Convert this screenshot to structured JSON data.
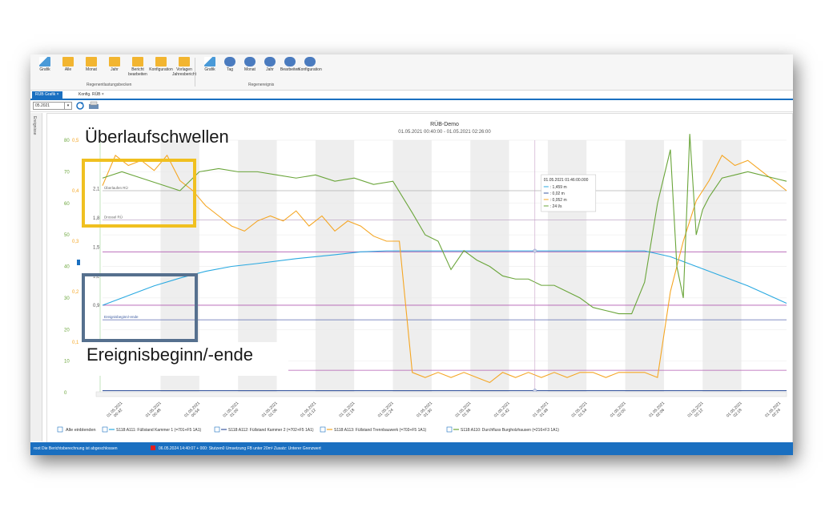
{
  "ribbon": {
    "buttons_left": [
      {
        "label": "Grafik",
        "icon": "chart-icon"
      },
      {
        "label": "Alle",
        "icon": "calendar-icon"
      },
      {
        "label": "Monat",
        "icon": "calendar-icon"
      },
      {
        "label": "Jahr",
        "icon": "calendar-icon"
      },
      {
        "label": "Bericht bearbeiten",
        "icon": "edit-icon"
      },
      {
        "label": "Konfiguration",
        "icon": "config-icon"
      },
      {
        "label": "Vorlagen Jahresbericht",
        "icon": "document-icon"
      }
    ],
    "group_left": "Regenentlastungsbecken",
    "buttons_right": [
      {
        "label": "Grafik",
        "icon": "chart-icon"
      },
      {
        "label": "Tag",
        "icon": "cloud-icon"
      },
      {
        "label": "Monat",
        "icon": "cloud-icon"
      },
      {
        "label": "Jahr",
        "icon": "cloud-icon"
      },
      {
        "label": "Bearbeiten",
        "icon": "cloud-edit-icon"
      },
      {
        "label": "Konfiguration",
        "icon": "cloud-icon"
      }
    ],
    "group_right": "Regenereignis"
  },
  "tabs": [
    {
      "label": "RÜB Grafik",
      "active": true
    },
    {
      "label": "Konfig. RÜB",
      "active": false
    }
  ],
  "toolbar": {
    "date_value": "05.2021"
  },
  "sidebar": {
    "label": "Ereignisse"
  },
  "overlays": {
    "thresholds": "Überlaufschwellen",
    "event": "Ereignisbeginn/-ende"
  },
  "colors": {
    "blue_series": "#29a9e1",
    "navy_series": "#3b5aa0",
    "orange_series": "#f5a623",
    "green_series": "#6aa53a",
    "threshold_lines": "#b05ab0",
    "accent": "#1a6fc0"
  },
  "chart_data": {
    "type": "line",
    "title": "RÜB-Demo",
    "subtitle": "01.05.2021 00:40:00 - 01.05.2021 02:26:00",
    "x_ticks": [
      "01.05.2021 00:42",
      "01.05.2021 00:48",
      "01.05.2021 00:54",
      "01.05.2021 01:00",
      "01.05.2021 01:06",
      "01.05.2021 01:12",
      "01.05.2021 01:18",
      "01.05.2021 01:24",
      "01.05.2021 01:30",
      "01.05.2021 01:36",
      "01.05.2021 01:42",
      "01.05.2021 01:48",
      "01.05.2021 01:54",
      "01.05.2021 02:00",
      "01.05.2021 02:06",
      "01.05.2021 02:12",
      "01.05.2021 02:18",
      "01.05.2021 02:24"
    ],
    "x_range": [
      0,
      106
    ],
    "y_axes": {
      "green": {
        "ticks": [
          "0",
          "10",
          "20",
          "30",
          "40",
          "50",
          "60",
          "70",
          "80"
        ],
        "range": [
          0,
          80
        ]
      },
      "orange": {
        "ticks": [
          "0,1",
          "0,2",
          "0,3",
          "0,4",
          "0,5"
        ],
        "range": [
          0,
          0.5
        ]
      },
      "blue": {
        "ticks": [
          "0,9",
          "1,2",
          "1,5",
          "1,8",
          "2,1"
        ],
        "range": [
          0,
          2.6
        ]
      }
    },
    "threshold_labels": [
      "Überlaufen RÜ",
      "Drossel RÜ",
      "Ereignisbeginn/-ende"
    ],
    "series": [
      {
        "name": "S118:A111: Füllstand Kammer 1 (=701+F5 1A1)",
        "color": "#29a9e1",
        "axis": "blue",
        "x": [
          0,
          4,
          8,
          12,
          16,
          20,
          24,
          30,
          36,
          40,
          44,
          48,
          52,
          56,
          60,
          64,
          68,
          72,
          76,
          80,
          84,
          88,
          92,
          96,
          100,
          104,
          106
        ],
        "values": [
          0.9,
          1.0,
          1.1,
          1.18,
          1.25,
          1.3,
          1.33,
          1.38,
          1.42,
          1.45,
          1.46,
          1.46,
          1.46,
          1.46,
          1.46,
          1.46,
          1.46,
          1.46,
          1.46,
          1.46,
          1.46,
          1.4,
          1.3,
          1.2,
          1.1,
          0.98,
          0.92
        ]
      },
      {
        "name": "S118:A112: Füllstand Kammer 2 (=702+F5 1A1)",
        "color": "#3b5aa0",
        "axis": "blue",
        "x": [
          0,
          106
        ],
        "values": [
          0.02,
          0.02
        ]
      },
      {
        "name": "S118:A113: Füllstand Trennbauwerk (=703+F5 1A1)",
        "color": "#f5a623",
        "axis": "orange",
        "x": [
          0,
          2,
          4,
          6,
          8,
          10,
          12,
          14,
          16,
          18,
          20,
          22,
          24,
          26,
          28,
          30,
          32,
          34,
          36,
          38,
          40,
          42,
          44,
          46,
          48,
          50,
          52,
          54,
          56,
          58,
          60,
          62,
          64,
          66,
          68,
          70,
          72,
          74,
          76,
          78,
          80,
          82,
          84,
          86,
          88,
          90,
          92,
          94,
          96,
          98,
          100,
          102,
          104,
          106
        ],
        "values": [
          0.41,
          0.47,
          0.45,
          0.46,
          0.44,
          0.47,
          0.42,
          0.4,
          0.37,
          0.35,
          0.33,
          0.32,
          0.34,
          0.35,
          0.34,
          0.36,
          0.33,
          0.35,
          0.32,
          0.34,
          0.33,
          0.31,
          0.3,
          0.3,
          0.04,
          0.03,
          0.04,
          0.03,
          0.04,
          0.03,
          0.02,
          0.04,
          0.03,
          0.04,
          0.03,
          0.04,
          0.03,
          0.04,
          0.04,
          0.03,
          0.04,
          0.04,
          0.04,
          0.03,
          0.2,
          0.3,
          0.38,
          0.42,
          0.47,
          0.45,
          0.46,
          0.44,
          0.42,
          0.4
        ]
      },
      {
        "name": "S118:A110: Durchfluss Burgholzhausen (=216+F3 1A1)",
        "color": "#6aa53a",
        "axis": "green",
        "x": [
          0,
          3,
          6,
          9,
          12,
          15,
          18,
          21,
          24,
          27,
          30,
          33,
          36,
          39,
          42,
          45,
          48,
          50,
          52,
          54,
          56,
          58,
          60,
          62,
          64,
          66,
          68,
          70,
          72,
          74,
          76,
          78,
          80,
          82,
          84,
          86,
          88,
          89,
          90,
          91,
          92,
          93,
          94,
          96,
          98,
          100,
          102,
          104,
          106
        ],
        "values": [
          68,
          70,
          68,
          66,
          64,
          70,
          71,
          70,
          70,
          69,
          68,
          69,
          67,
          68,
          66,
          67,
          57,
          50,
          48,
          39,
          45,
          42,
          40,
          37,
          36,
          36,
          34,
          34,
          32,
          30,
          27,
          26,
          25,
          25,
          35,
          60,
          77,
          40,
          30,
          82,
          50,
          58,
          62,
          68,
          69,
          70,
          69,
          68,
          67
        ]
      }
    ],
    "cursor": {
      "x": 67,
      "label": "01.05.2021 01:46:00.000",
      "values": [
        "1,459 m",
        "0,02 m",
        "0,052 m",
        "24 l/s"
      ]
    },
    "legend": {
      "show_all_label": "Alle einblenden",
      "position": "bottom"
    }
  },
  "statusbar": {
    "left": "root  Die Berichtsberechnung ist abgeschlossen",
    "right": "06.05.2024 14:40:07 + 000: Stutzen0 Umsetzung FB unter 20m³ Zusatz: Unterer Grenzwert"
  }
}
